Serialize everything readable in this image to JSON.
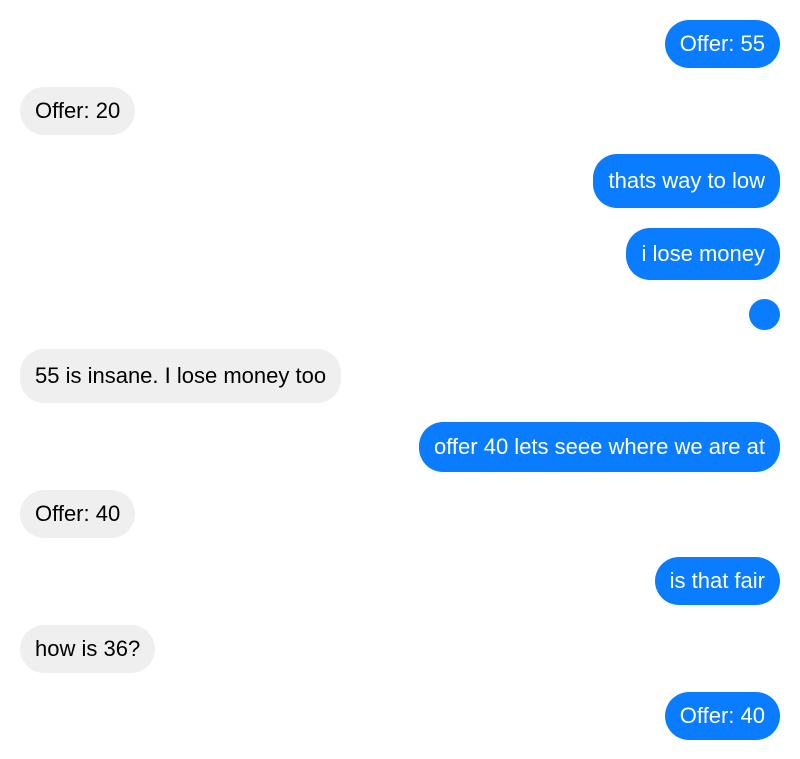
{
  "colors": {
    "sent_bubble": "#0a7cff",
    "received_bubble": "#efefef",
    "sent_text": "#ffffff",
    "received_text": "#000000"
  },
  "messages": [
    {
      "sender": "me",
      "text": "Offer: 55"
    },
    {
      "sender": "them",
      "text": "Offer: 20"
    },
    {
      "sender": "me",
      "text": "thats way to low"
    },
    {
      "sender": "me",
      "text": "i lose money"
    },
    {
      "sender": "me",
      "text": ""
    },
    {
      "sender": "them",
      "text": "55 is insane. I lose money too"
    },
    {
      "sender": "me",
      "text": "offer 40 lets seee where we are at"
    },
    {
      "sender": "them",
      "text": "Offer: 40"
    },
    {
      "sender": "me",
      "text": "is that fair"
    },
    {
      "sender": "them",
      "text": "how is 36?"
    },
    {
      "sender": "me",
      "text": "Offer: 40"
    }
  ]
}
